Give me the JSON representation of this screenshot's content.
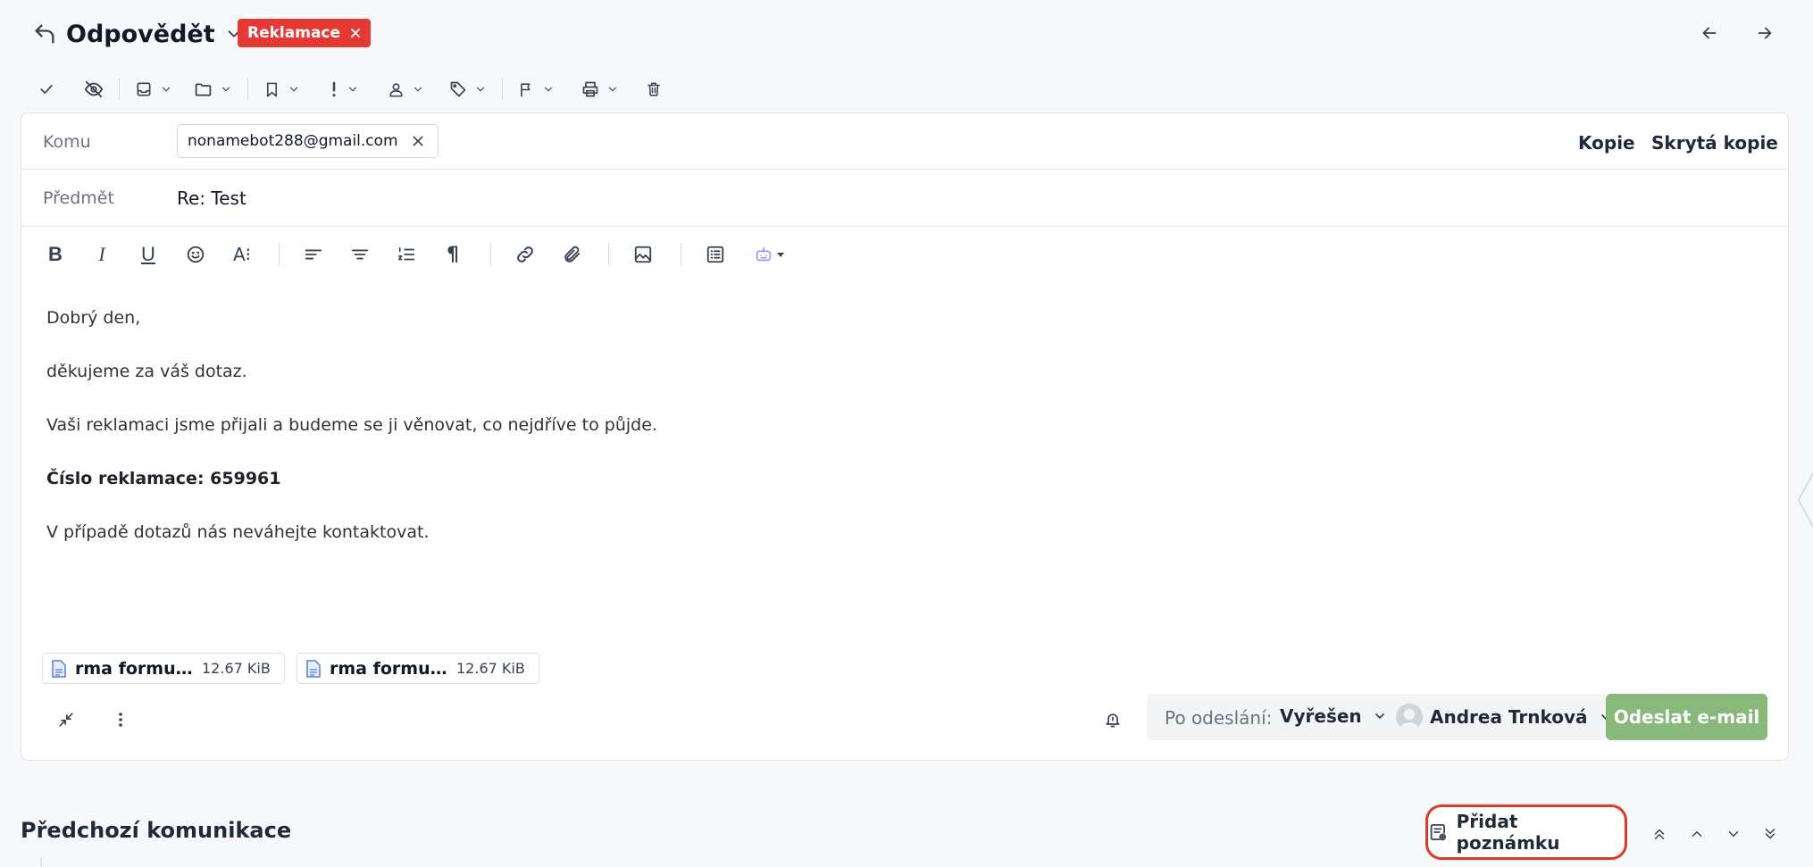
{
  "header": {
    "reply_label": "Odpovědět",
    "tag_label": "Reklamace"
  },
  "toolbar": {
    "icons": [
      "check-icon",
      "eye-off-icon",
      "inbox-icon",
      "folder-icon",
      "bookmark-icon",
      "priority-icon",
      "user-icon",
      "tag-icon",
      "flag-icon",
      "printer-icon",
      "trash-icon"
    ]
  },
  "composer": {
    "to_label": "Komu",
    "to_recipient": "nonamebot288@gmail.com",
    "cc_label": "Kopie",
    "bcc_label": "Skrytá kopie",
    "subject_label": "Předmět",
    "subject_value": "Re: Test",
    "body": {
      "greeting": "Dobrý den,",
      "thanks": "děkujeme za váš dotaz.",
      "message": "Vaši reklamaci jsme přijali a budeme se ji věnovat, co nejdříve to půjde.",
      "claim_number": "Číslo reklamace: 659961",
      "closing": "V případě dotazů nás neváhejte kontaktovat."
    },
    "attachments": [
      {
        "name": "rma formulář.pdf",
        "size": "12.67 KiB"
      },
      {
        "name": "rma formulář.pdf",
        "size": "12.67 KiB"
      }
    ]
  },
  "footer": {
    "after_send_label": "Po odeslání:",
    "status_value": "Vyřešen",
    "assignee": "Andrea Trnková",
    "send_label": "Odeslat e-mail"
  },
  "previous": {
    "title": "Předchozí komunikace",
    "add_note_label": "Přidat poznámku"
  },
  "colors": {
    "tag": "#e53935",
    "send_button": "#88b87a",
    "highlight": "#d93b2b"
  }
}
